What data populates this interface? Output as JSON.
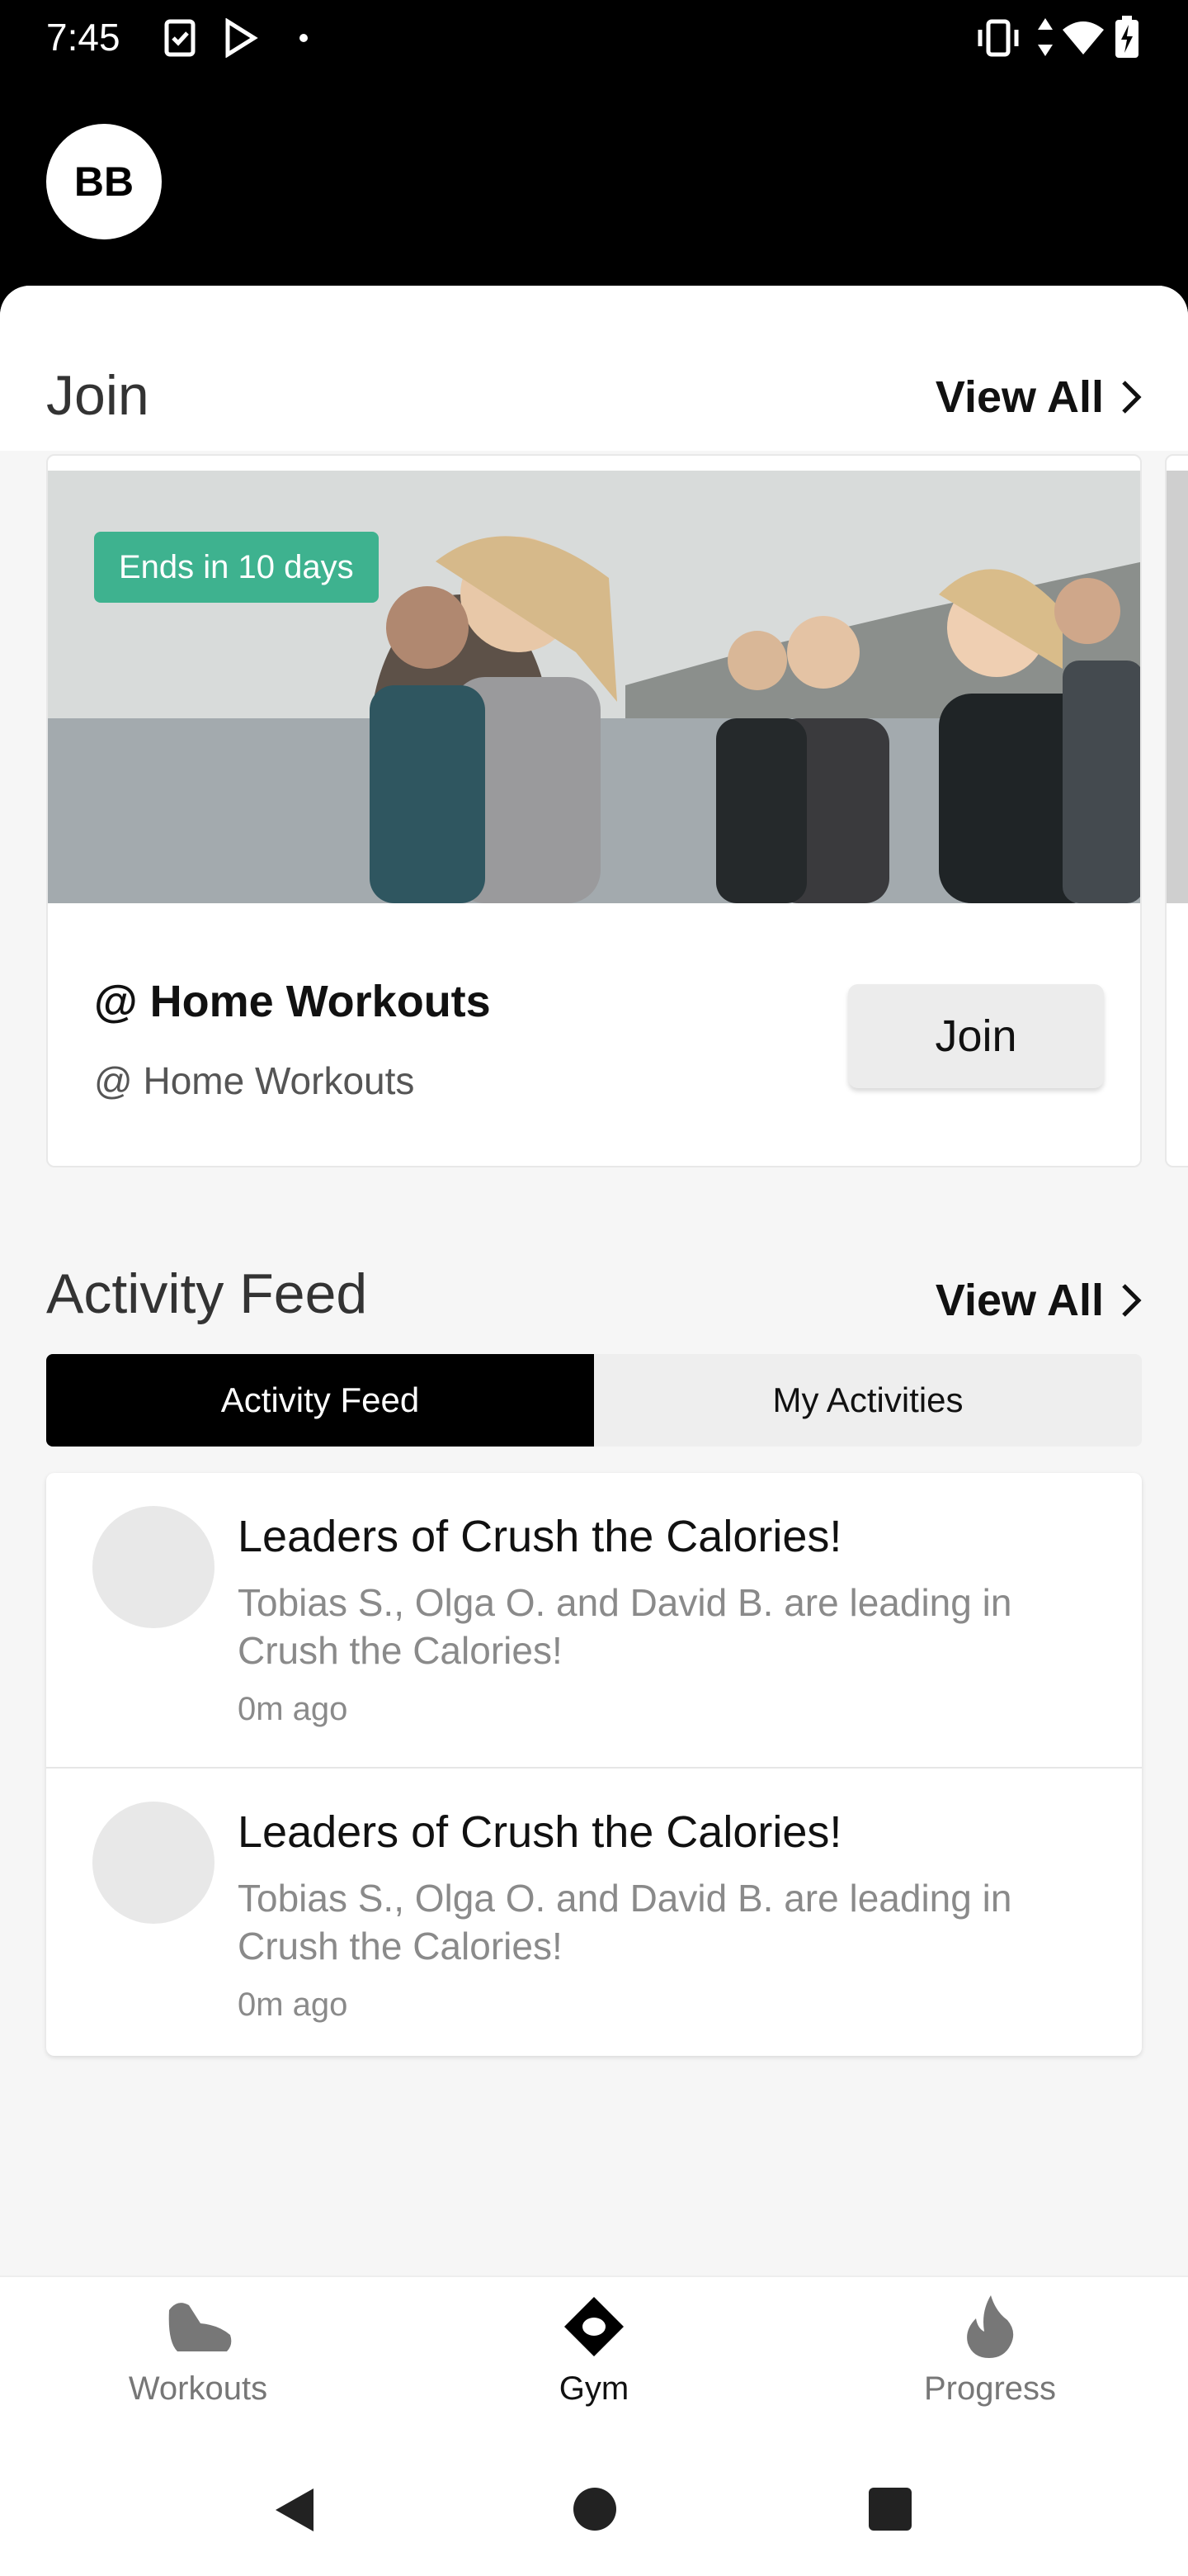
{
  "status_bar": {
    "time": "7:45"
  },
  "header": {
    "avatar_initials": "BB"
  },
  "join_section": {
    "title": "Join",
    "view_all": "View All",
    "card": {
      "badge": "Ends in 10 days",
      "title": "@ Home Workouts",
      "subtitle": "@ Home Workouts",
      "button": "Join"
    }
  },
  "activity_section": {
    "title": "Activity Feed",
    "view_all": "View All",
    "tabs": [
      {
        "label": "Activity Feed",
        "active": true
      },
      {
        "label": "My Activities",
        "active": false
      }
    ],
    "items": [
      {
        "title": "Leaders of Crush the Calories!",
        "description": "Tobias S., Olga O. and David B. are leading in Crush the Calories!",
        "time": "0m ago"
      },
      {
        "title": "Leaders of Crush the Calories!",
        "description": "Tobias S., Olga O. and David B. are leading in Crush the Calories!",
        "time": "0m ago"
      }
    ]
  },
  "bottom_nav": {
    "items": [
      {
        "label": "Workouts",
        "icon": "shoe-icon",
        "active": false
      },
      {
        "label": "Gym",
        "icon": "gym-icon",
        "active": true
      },
      {
        "label": "Progress",
        "icon": "flame-icon",
        "active": false
      }
    ]
  },
  "colors": {
    "badge": "#3eb28f",
    "active_tab": "#000000",
    "nav_inactive": "#777777"
  }
}
